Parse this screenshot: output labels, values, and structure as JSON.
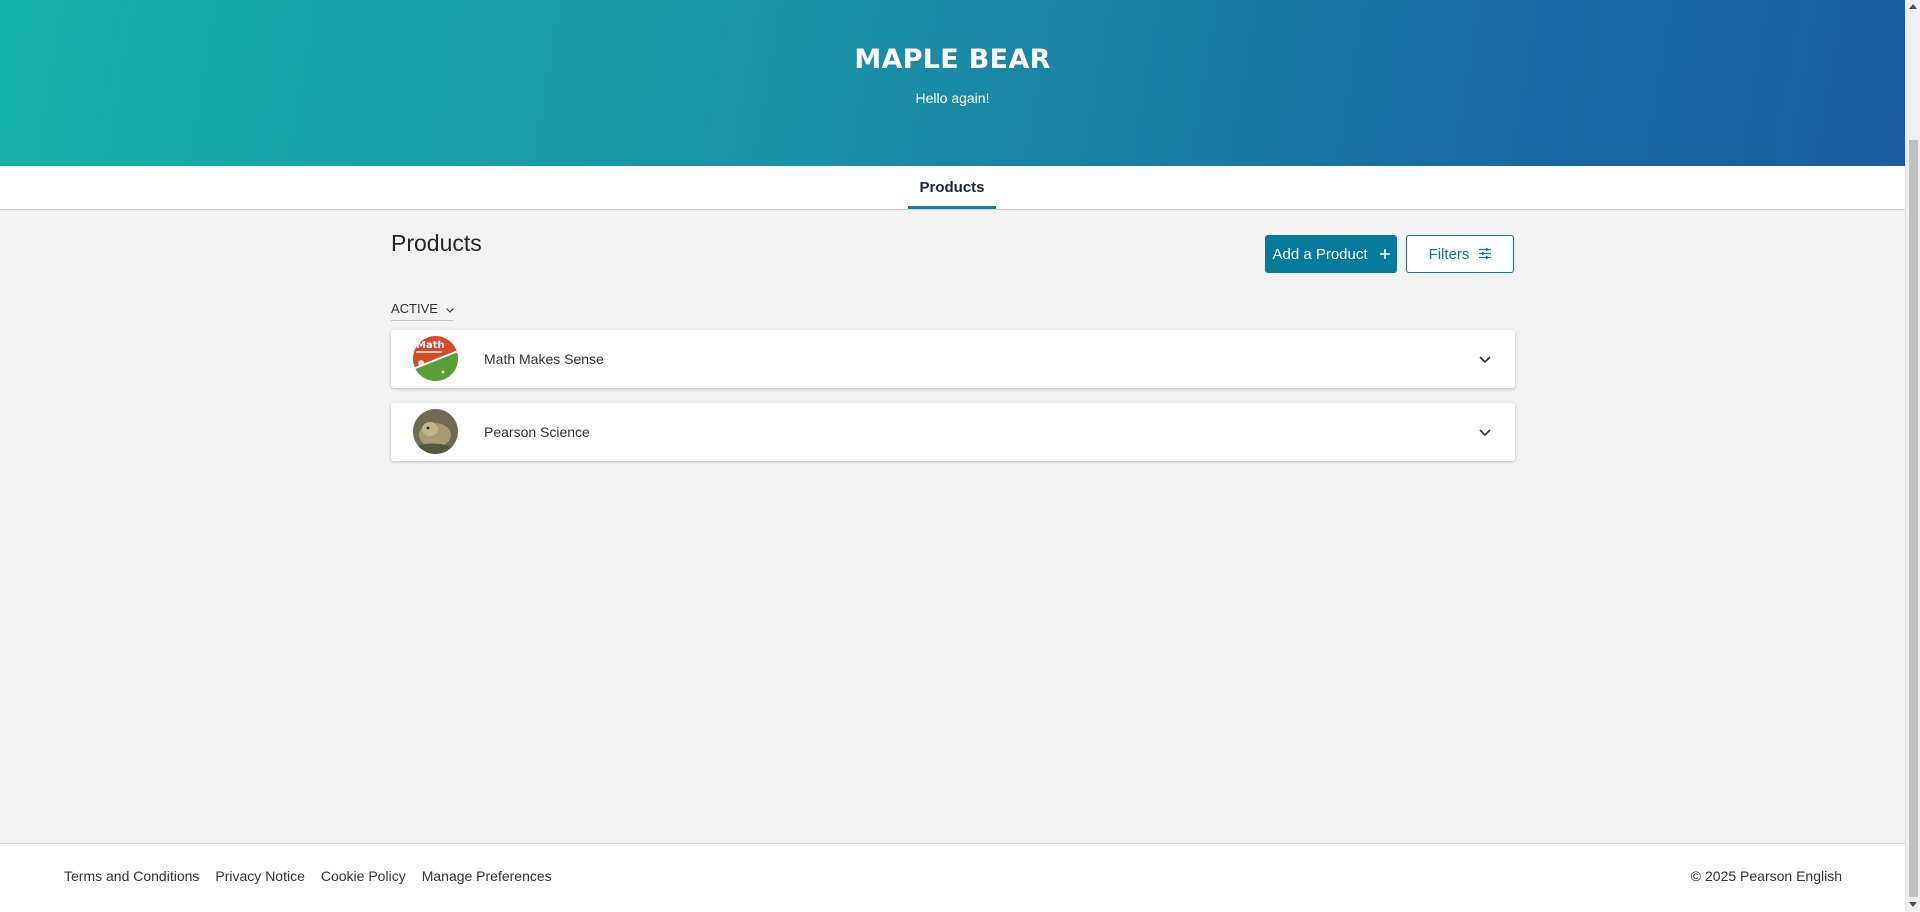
{
  "header": {
    "title": "MAPLE BEAR",
    "subtitle": "Hello again!"
  },
  "tabs": [
    {
      "label": "Products",
      "active": true
    }
  ],
  "main": {
    "title": "Products",
    "add_button_label": "Add a Product",
    "filters_button_label": "Filters",
    "status_filter": "ACTIVE",
    "products": [
      {
        "name": "Math Makes Sense",
        "thumbnail": "math-book-cover"
      },
      {
        "name": "Pearson Science",
        "thumbnail": "science-animal-photo"
      }
    ]
  },
  "footer": {
    "links": [
      "Terms and Conditions",
      "Privacy Notice",
      "Cookie Policy",
      "Manage Preferences"
    ],
    "copyright": "© 2025 Pearson English"
  },
  "colors": {
    "primary": "#047a9c",
    "tab_indicator": "#1a7fa0",
    "header_gradient_start": "#16b2a8",
    "header_gradient_end": "#1a5e9f"
  }
}
